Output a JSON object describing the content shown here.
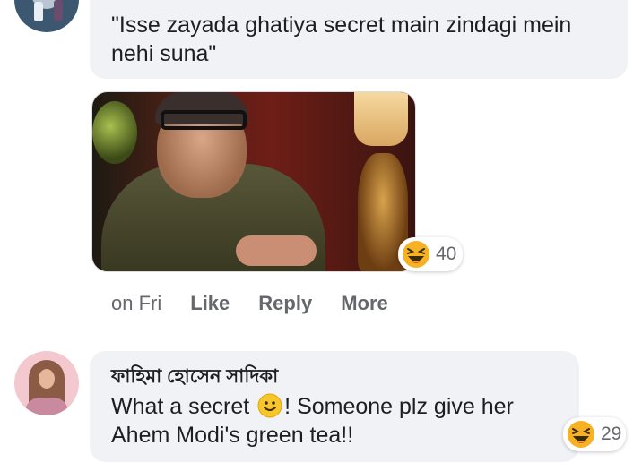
{
  "comments": [
    {
      "text": "\"Isse zayada ghatiya secret main zindagi mein nehi suna\"",
      "attachment_icon": "photo-attachment",
      "reactions": {
        "icon": "haha-emoji",
        "count": "40"
      },
      "actions": {
        "time": "on Fri",
        "like": "Like",
        "reply": "Reply",
        "more": "More"
      }
    },
    {
      "author": "ফাহিমা হোসেন সাদিকা",
      "text_before_emoji": "What a secret ",
      "emoji": "slightly-smiling-face",
      "text_after_emoji": "! Someone plz give her Ahem Modi's green tea!!",
      "reactions": {
        "icon": "haha-emoji",
        "count": "29"
      }
    }
  ],
  "colors": {
    "bubble_bg": "#f0f2f5",
    "secondary_text": "#65676b",
    "primary_text": "#1c1e21",
    "reaction_yellow": "#f7b125"
  }
}
